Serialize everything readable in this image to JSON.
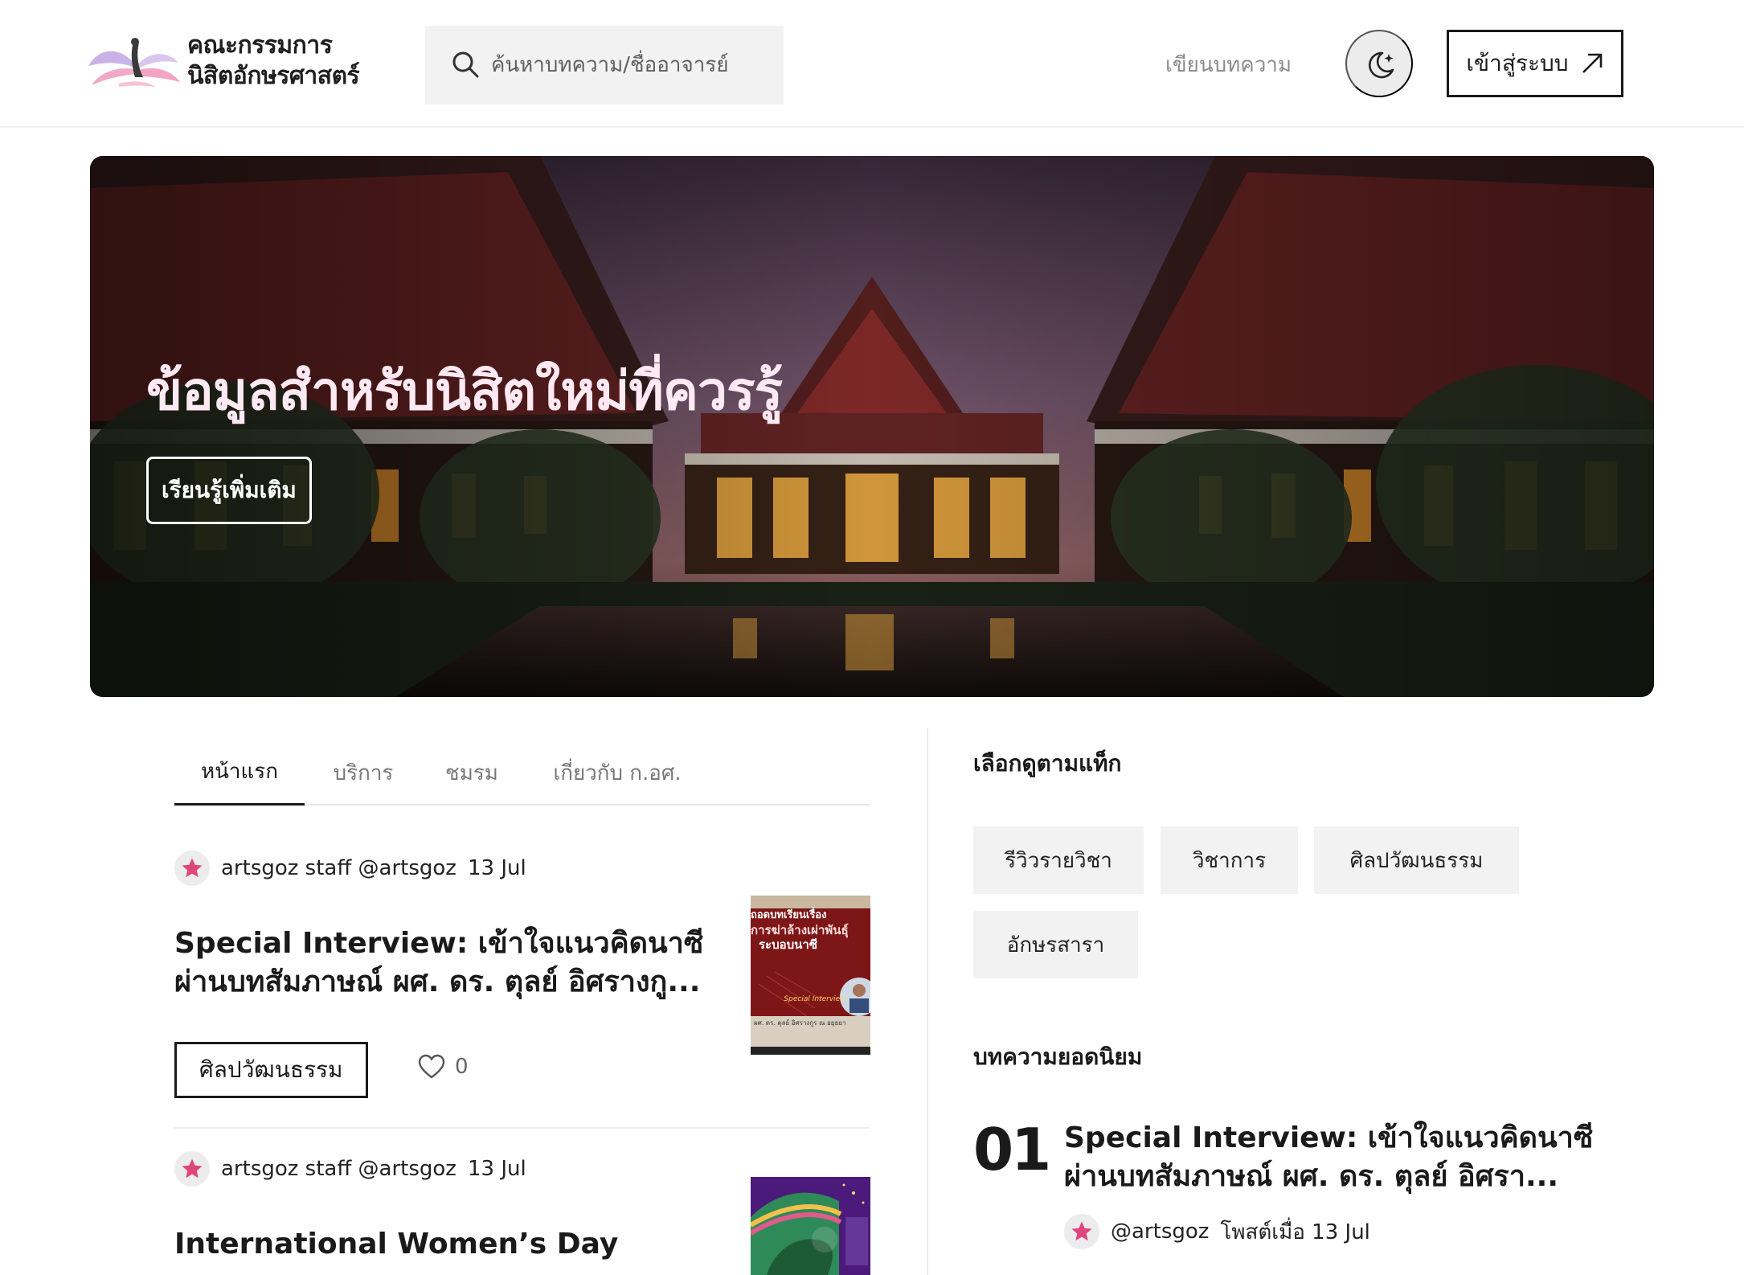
{
  "header": {
    "logo_line1": "คณะกรรมการ",
    "logo_line2": "นิสิตอักษรศาสตร์",
    "search_placeholder": "ค้นหาบทความ/ชื่ออาจารย์",
    "write_link": "เขียนบทความ",
    "login_label": "เข้าสู่ระบบ",
    "icons": {
      "search": "search-icon",
      "dark_mode": "moon-star-icon",
      "login": "arrow-up-right-icon"
    }
  },
  "hero": {
    "title": "ข้อมูลสำหรับนิสิตใหม่ที่ควรรู้",
    "button": "เรียนรู้เพิ่มเติม"
  },
  "tabs": [
    {
      "label": "หน้าแรก",
      "active": true
    },
    {
      "label": "บริการ",
      "active": false
    },
    {
      "label": "ชมรม",
      "active": false
    },
    {
      "label": "เกี่ยวกับ ก.อศ.",
      "active": false
    }
  ],
  "articles": [
    {
      "author": "artsgoz staff @artsgoz",
      "date": "13 Jul",
      "title_line1": "Special Interview: เข้าใจแนวคิดนาซี",
      "title_line2": "ผ่านบทสัมภาษณ์ ผศ. ดร. ตุลย์ อิศรางกู...",
      "tag": "ศิลปวัฒนธรรม",
      "likes": "0",
      "thumb": {
        "line1": "ถอดบทเรียนเรื่อง",
        "line2": "การฆ่าล้างเผ่าพันธุ์",
        "line3": "ระบอบนาซี",
        "badge": "Special Interview",
        "caption": "ผศ. ดร. ตุลย์ อิศรางกูร ณ อยุธยา"
      }
    },
    {
      "author": "artsgoz staff @artsgoz",
      "date": "13 Jul",
      "title_line1": "International Women’s Day"
    }
  ],
  "sidebar": {
    "tags_heading": "เลือกดูตามแท็ก",
    "tags": [
      "รีวิวรายวิชา",
      "วิชาการ",
      "ศิลปวัฒนธรรม",
      "อักษรสารา"
    ],
    "popular_heading": "บทความยอดนิยม",
    "popular": [
      {
        "rank": "01",
        "title_line1": "Special Interview: เข้าใจแนวคิดนาซี",
        "title_line2": "ผ่านบทสัมภาษณ์ ผศ. ดร. ตุลย์ อิศรา...",
        "author": "@artsgoz",
        "posted": "โพสต์เมื่อ 13 Jul"
      }
    ]
  },
  "colors": {
    "accent_star": "#e0457b",
    "hero_title": "#ffe9f3",
    "chip_bg": "#f2f2f2"
  }
}
